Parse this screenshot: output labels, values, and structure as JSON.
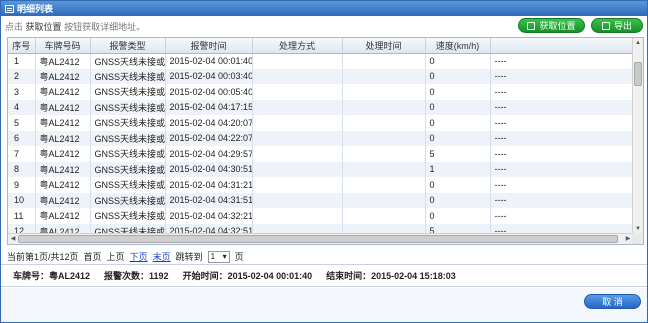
{
  "window": {
    "title": "明细列表"
  },
  "hint": {
    "prefix": "点击",
    "action": "获取位置",
    "suffix": "按钮获取详细地址。"
  },
  "toolbar": {
    "locate_label": "获取位置",
    "export_label": "导出"
  },
  "table": {
    "headers": [
      "序号",
      "车牌号码",
      "报警类型",
      "报警时间",
      "处理方式",
      "处理时间",
      "速度(km/h)",
      ""
    ],
    "rows": [
      [
        "1",
        "粤AL2412",
        "GNSS天线未接或被",
        "2015-02-04 00:01:40",
        "",
        "",
        "0",
        "----"
      ],
      [
        "2",
        "粤AL2412",
        "GNSS天线未接或被",
        "2015-02-04 00:03:40",
        "",
        "",
        "0",
        "----"
      ],
      [
        "3",
        "粤AL2412",
        "GNSS天线未接或被",
        "2015-02-04 00:05:40",
        "",
        "",
        "0",
        "----"
      ],
      [
        "4",
        "粤AL2412",
        "GNSS天线未接或被",
        "2015-02-04 04:17:15",
        "",
        "",
        "0",
        "----"
      ],
      [
        "5",
        "粤AL2412",
        "GNSS天线未接或被",
        "2015-02-04 04:20:07",
        "",
        "",
        "0",
        "----"
      ],
      [
        "6",
        "粤AL2412",
        "GNSS天线未接或被",
        "2015-02-04 04:22:07",
        "",
        "",
        "0",
        "----"
      ],
      [
        "7",
        "粤AL2412",
        "GNSS天线未接或被",
        "2015-02-04 04:29:57",
        "",
        "",
        "5",
        "----"
      ],
      [
        "8",
        "粤AL2412",
        "GNSS天线未接或被",
        "2015-02-04 04:30:51",
        "",
        "",
        "1",
        "----"
      ],
      [
        "9",
        "粤AL2412",
        "GNSS天线未接或被",
        "2015-02-04 04:31:21",
        "",
        "",
        "0",
        "----"
      ],
      [
        "10",
        "粤AL2412",
        "GNSS天线未接或被",
        "2015-02-04 04:31:51",
        "",
        "",
        "0",
        "----"
      ],
      [
        "11",
        "粤AL2412",
        "GNSS天线未接或被",
        "2015-02-04 04:32:21",
        "",
        "",
        "0",
        "----"
      ],
      [
        "12",
        "粤AL2412",
        "GNSS天线未接或被",
        "2015-02-04 04:32:51",
        "",
        "",
        "5",
        "----"
      ]
    ]
  },
  "pager": {
    "status": "当前第1页/共12页",
    "first": "首页",
    "prev": "上页",
    "next": "下页",
    "last": "末页",
    "jump_label": "跳转到",
    "page_value": "1",
    "page_suffix": "页"
  },
  "summary": {
    "plate": "车牌号：粤AL2412",
    "count": "报警次数：1192",
    "start": "开始时间：2015-02-04 00:01:40",
    "end": "结束时间：2015-02-04 15:18:03"
  },
  "footer": {
    "cancel_label": "取 消"
  }
}
